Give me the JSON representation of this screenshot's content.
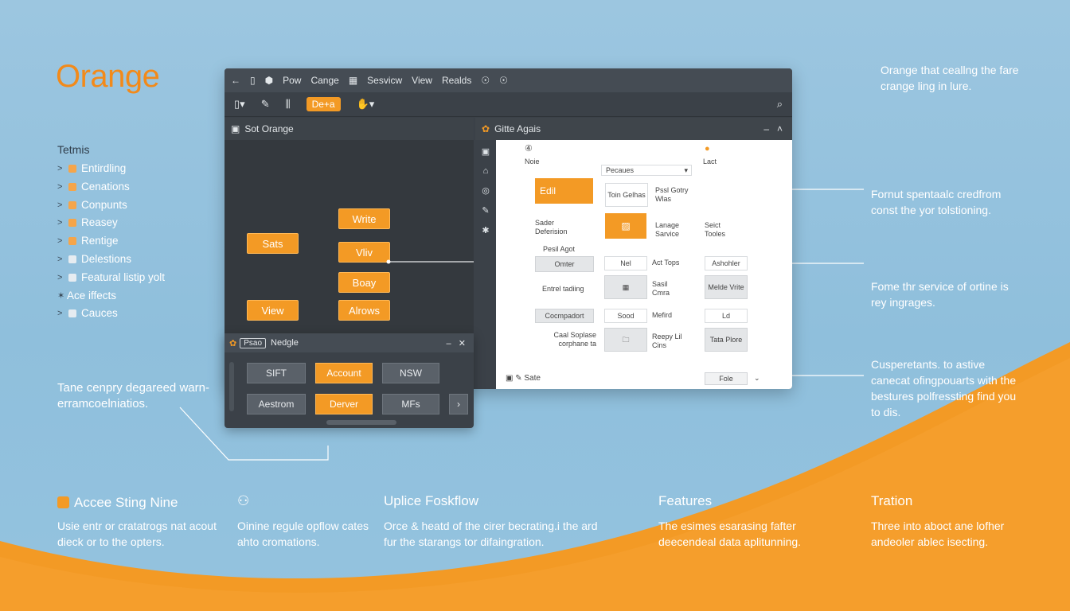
{
  "brand": "Orange",
  "toc": {
    "title": "Tetmis",
    "items": [
      {
        "label": "Entirdling",
        "prefix": ">"
      },
      {
        "label": "Cenations",
        "prefix": ">"
      },
      {
        "label": "Conpunts",
        "prefix": ">"
      },
      {
        "label": "Reasey",
        "prefix": ">"
      },
      {
        "label": "Rentige",
        "prefix": ">"
      },
      {
        "label": "Delestions",
        "prefix": ">"
      },
      {
        "label": "Featural listip yolt",
        "prefix": ">"
      },
      {
        "label": "Ace iffects",
        "prefix": "✶"
      },
      {
        "label": "Cauces",
        "prefix": ">"
      }
    ]
  },
  "left_note": "Tane cenpry degareed warn-erramcoelniatios.",
  "window": {
    "menu": [
      "←",
      "▯",
      "⬢",
      "Pow",
      "Cange",
      "▦",
      "Sesvicw",
      "View",
      "Realds",
      "☉",
      "☉"
    ],
    "toolbar": {
      "active": "De+a",
      "right_icon": "search-zoom"
    },
    "canvas_title": "Sot Orange",
    "nodes": [
      "Write",
      "Sats",
      "Vliv",
      "Boay",
      "View",
      "Alrows"
    ],
    "panel_title": "Gitte Agais",
    "panel": {
      "none_label": "Noie",
      "last_label": "Lact",
      "select_value": "Pecaues",
      "edit_button": "Edil",
      "toin_label": "Toin Gelhas",
      "pssi_label": "Pssl Gotry Wlas",
      "sader_label": "Sader Deferision",
      "lanage_label": "Lanage Sarvice",
      "sect_label": "Seict Tooles",
      "pesi_label": "Pesil Agot",
      "omter": "Omter",
      "nel": "Nel",
      "act_tops": "Act Tops",
      "asholer": "Ashohler",
      "entel_trading": "Entrel tadiing",
      "sasil_cmra": "Sasil Cmra",
      "medie_vrite": "Melde Vrite",
      "coompadort": "Cocmpadort",
      "sood": "Sood",
      "mefird": "Mefird",
      "ld": "Ld",
      "caal_scplase": "Caal Soplase corphane ta",
      "reepy_lil": "Reepy Lil Cins",
      "tata_plore": "Tata Plore",
      "status_left": "Sate",
      "status_right": "Fole"
    }
  },
  "subwindow": {
    "tag": "Psao",
    "title": "Nedgle",
    "buttons": [
      {
        "label": "SIFT",
        "orange": false
      },
      {
        "label": "Account",
        "orange": true
      },
      {
        "label": "NSW",
        "orange": false
      },
      {
        "label": "Aestrom",
        "orange": false
      },
      {
        "label": "Derver",
        "orange": true
      },
      {
        "label": "MFs",
        "orange": false
      }
    ]
  },
  "right_notes": [
    "Orange that ceallng the fare crange ling in lure.",
    "Fornut spentaalc credfrom const the yor tolstioning.",
    "Fome thr service of ortine is rey ingrages.",
    "Cusperetants. to astive canecat ofingpouarts with the bestures polfressting find you to dis."
  ],
  "features": [
    {
      "title": "Accee Sting Nine",
      "desc": "Usie entr or cratatrogs nat acout dieck or to the opters."
    },
    {
      "title": "",
      "desc": "Oinine regule opflow cates ahto cromations."
    },
    {
      "title": "Uplice Foskflow",
      "desc": "Orce & heatd of the cirer becrating.i the ard fur the starangs tor difaingration."
    },
    {
      "title": "Features",
      "desc": "The esimes esarasing fafter deecendeal data aplitunning."
    },
    {
      "title": "Tration",
      "desc": "Three into aboct ane lofher andeoler ablec isecting."
    }
  ],
  "colors": {
    "accent": "#f39a25",
    "background": "#9cc6e0",
    "window": "#3b4148"
  }
}
